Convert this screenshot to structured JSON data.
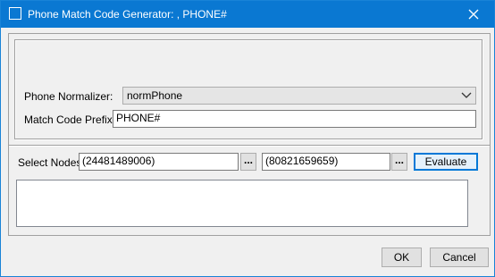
{
  "window": {
    "title": "Phone Match Code Generator: , PHONE#",
    "close_glyph": "✕"
  },
  "form": {
    "phone_normalizer_label": "Phone Normalizer:",
    "phone_normalizer_value": "normPhone",
    "match_code_prefix_label": "Match Code Prefix:",
    "match_code_prefix_value": "PHONE#"
  },
  "nodes": {
    "select_nodes_label": "Select Nodes",
    "node_1_value": "(24481489006)",
    "node_2_value": "(80821659659)",
    "browse_label": "...",
    "evaluate_label": "Evaluate"
  },
  "result": {
    "text": ""
  },
  "footer": {
    "ok_label": "OK",
    "cancel_label": "Cancel"
  },
  "icons": {
    "window_icon": "window-icon",
    "close": "close-icon",
    "dropdown": "chevron-down-icon"
  },
  "colors": {
    "titlebar": "#0a78d2",
    "focus_accent": "#0078d7",
    "dialog_bg": "#f0f0f0"
  }
}
